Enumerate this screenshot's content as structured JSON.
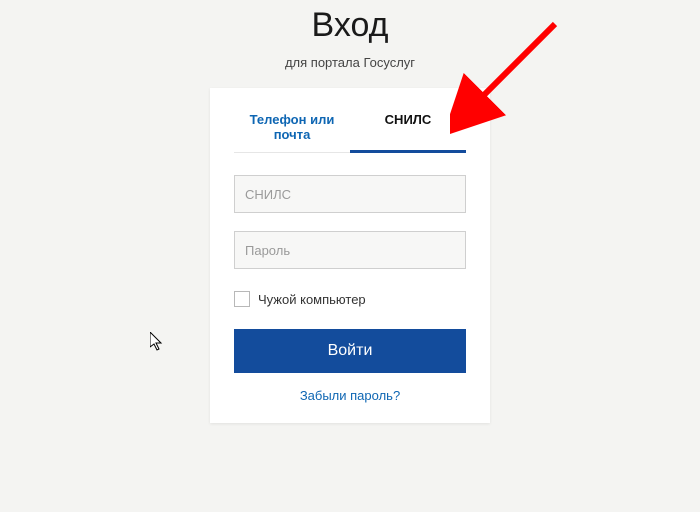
{
  "header": {
    "title": "Вход",
    "subtitle": "для портала Госуслуг"
  },
  "tabs": {
    "phone_email": "Телефон или почта",
    "snils": "СНИЛС"
  },
  "form": {
    "snils_placeholder": "СНИЛС",
    "password_placeholder": "Пароль",
    "foreign_computer_label": "Чужой компьютер",
    "login_button": "Войти",
    "forgot_password": "Забыли пароль?"
  },
  "colors": {
    "accent": "#134c9c",
    "link": "#0e66b3",
    "arrow": "#ff0000"
  }
}
